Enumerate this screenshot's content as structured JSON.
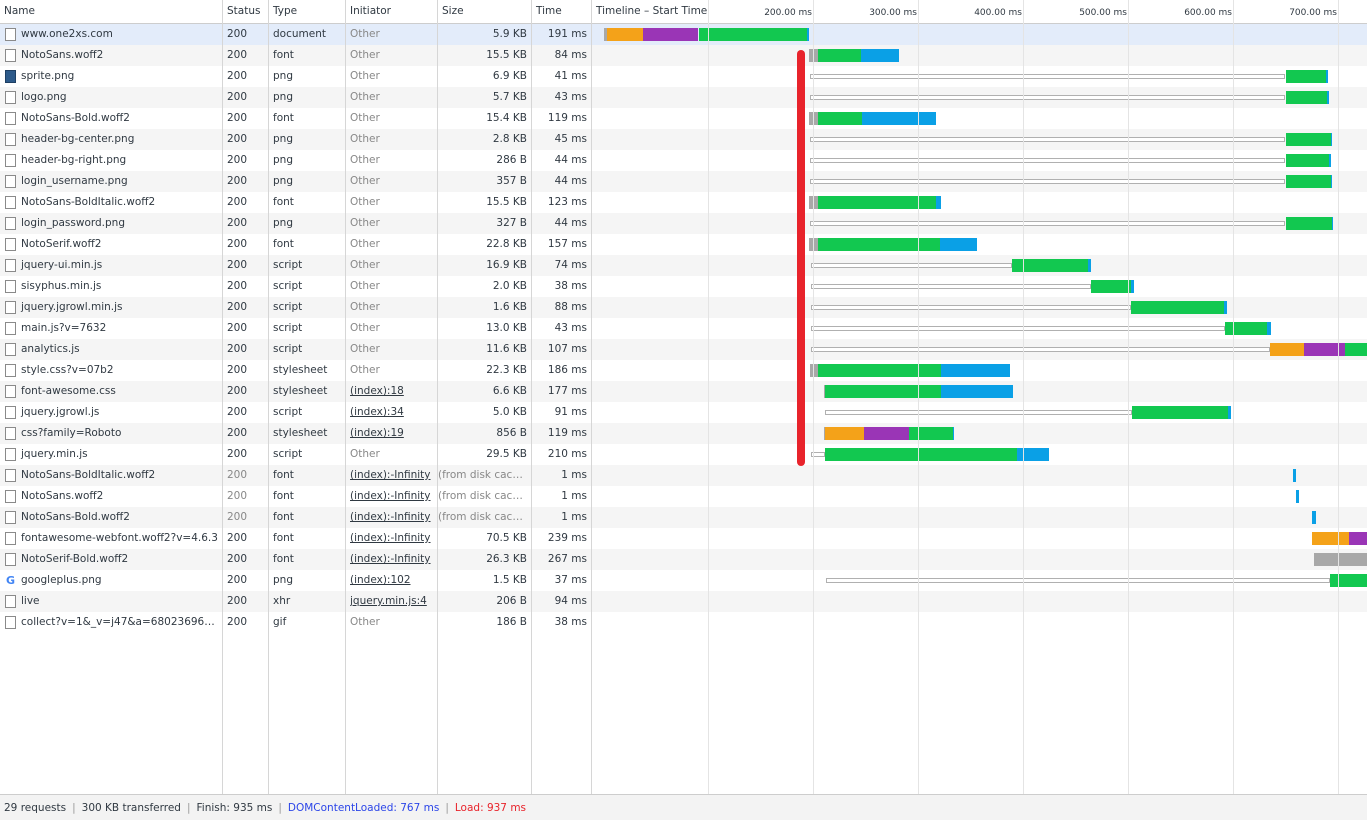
{
  "columns": {
    "name": "Name",
    "status": "Status",
    "type": "Type",
    "initiator": "Initiator",
    "size": "Size",
    "time": "Time",
    "timeline": "Timeline – Start Time"
  },
  "timeline_ticks": [
    "200.00 ms",
    "300.00 ms",
    "400.00 ms",
    "500.00 ms",
    "600.00 ms",
    "700.00 ms"
  ],
  "colors": {
    "stalled": "#a8a8a8",
    "dns": "#f4a219",
    "ssl": "#9a35b6",
    "ttfb": "#12c850",
    "download": "#0aa0e6",
    "dom_content_loaded": "#2b45e8",
    "load": "#e8232b",
    "annotation_highlight": "#e8232b"
  },
  "requests": [
    {
      "name": "www.one2xs.com",
      "status": "200",
      "type": "document",
      "initiator": "Other",
      "size": "5.9 KB",
      "time": "191 ms",
      "icon": "document-icon"
    },
    {
      "name": "NotoSans.woff2",
      "status": "200",
      "type": "font",
      "initiator": "Other",
      "size": "15.5 KB",
      "time": "84 ms",
      "icon": "file-icon"
    },
    {
      "name": "sprite.png",
      "status": "200",
      "type": "png",
      "initiator": "Other",
      "size": "6.9 KB",
      "time": "41 ms",
      "icon": "image-icon"
    },
    {
      "name": "logo.png",
      "status": "200",
      "type": "png",
      "initiator": "Other",
      "size": "5.7 KB",
      "time": "43 ms",
      "icon": "file-icon"
    },
    {
      "name": "NotoSans-Bold.woff2",
      "status": "200",
      "type": "font",
      "initiator": "Other",
      "size": "15.4 KB",
      "time": "119 ms",
      "icon": "file-icon"
    },
    {
      "name": "header-bg-center.png",
      "status": "200",
      "type": "png",
      "initiator": "Other",
      "size": "2.8 KB",
      "time": "45 ms",
      "icon": "file-icon"
    },
    {
      "name": "header-bg-right.png",
      "status": "200",
      "type": "png",
      "initiator": "Other",
      "size": "286 B",
      "time": "44 ms",
      "icon": "file-icon"
    },
    {
      "name": "login_username.png",
      "status": "200",
      "type": "png",
      "initiator": "Other",
      "size": "357 B",
      "time": "44 ms",
      "icon": "user-icon"
    },
    {
      "name": "NotoSans-BoldItalic.woff2",
      "status": "200",
      "type": "font",
      "initiator": "Other",
      "size": "15.5 KB",
      "time": "123 ms",
      "icon": "file-icon"
    },
    {
      "name": "login_password.png",
      "status": "200",
      "type": "png",
      "initiator": "Other",
      "size": "327 B",
      "time": "44 ms",
      "icon": "key-icon"
    },
    {
      "name": "NotoSerif.woff2",
      "status": "200",
      "type": "font",
      "initiator": "Other",
      "size": "22.8 KB",
      "time": "157 ms",
      "icon": "file-icon"
    },
    {
      "name": "jquery-ui.min.js",
      "status": "200",
      "type": "script",
      "initiator": "Other",
      "size": "16.9 KB",
      "time": "74 ms",
      "icon": "file-icon"
    },
    {
      "name": "sisyphus.min.js",
      "status": "200",
      "type": "script",
      "initiator": "Other",
      "size": "2.0 KB",
      "time": "38 ms",
      "icon": "file-icon"
    },
    {
      "name": "jquery.jgrowl.min.js",
      "status": "200",
      "type": "script",
      "initiator": "Other",
      "size": "1.6 KB",
      "time": "88 ms",
      "icon": "file-icon"
    },
    {
      "name": "main.js?v=7632",
      "status": "200",
      "type": "script",
      "initiator": "Other",
      "size": "13.0 KB",
      "time": "43 ms",
      "icon": "file-icon"
    },
    {
      "name": "analytics.js",
      "status": "200",
      "type": "script",
      "initiator": "Other",
      "size": "11.6 KB",
      "time": "107 ms",
      "icon": "file-icon"
    },
    {
      "name": "style.css?v=07b2",
      "status": "200",
      "type": "stylesheet",
      "initiator": "Other",
      "size": "22.3 KB",
      "time": "186 ms",
      "icon": "file-icon"
    },
    {
      "name": "font-awesome.css",
      "status": "200",
      "type": "stylesheet",
      "initiator": "(index):18",
      "size": "6.6 KB",
      "time": "177 ms",
      "icon": "file-icon"
    },
    {
      "name": "jquery.jgrowl.js",
      "status": "200",
      "type": "script",
      "initiator": "(index):34",
      "size": "5.0 KB",
      "time": "91 ms",
      "icon": "file-icon"
    },
    {
      "name": "css?family=Roboto",
      "status": "200",
      "type": "stylesheet",
      "initiator": "(index):19",
      "size": "856 B",
      "time": "119 ms",
      "icon": "file-icon"
    },
    {
      "name": "jquery.min.js",
      "status": "200",
      "type": "script",
      "initiator": "Other",
      "size": "29.5 KB",
      "time": "210 ms",
      "icon": "file-icon"
    },
    {
      "name": "NotoSans-BoldItalic.woff2",
      "status": "200",
      "type": "font",
      "initiator": "(index):-Infinity",
      "size": "(from disk cache)",
      "time": "1 ms",
      "icon": "file-icon"
    },
    {
      "name": "NotoSans.woff2",
      "status": "200",
      "type": "font",
      "initiator": "(index):-Infinity",
      "size": "(from disk cache)",
      "time": "1 ms",
      "icon": "file-icon"
    },
    {
      "name": "NotoSans-Bold.woff2",
      "status": "200",
      "type": "font",
      "initiator": "(index):-Infinity",
      "size": "(from disk cache)",
      "time": "1 ms",
      "icon": "file-icon"
    },
    {
      "name": "fontawesome-webfont.woff2?v=4.6.3",
      "status": "200",
      "type": "font",
      "initiator": "(index):-Infinity",
      "size": "70.5 KB",
      "time": "239 ms",
      "icon": "file-icon"
    },
    {
      "name": "NotoSerif-Bold.woff2",
      "status": "200",
      "type": "font",
      "initiator": "(index):-Infinity",
      "size": "26.3 KB",
      "time": "267 ms",
      "icon": "file-icon"
    },
    {
      "name": "googleplus.png",
      "status": "200",
      "type": "png",
      "initiator": "(index):102",
      "size": "1.5 KB",
      "time": "37 ms",
      "icon": "google-icon"
    },
    {
      "name": "live",
      "status": "200",
      "type": "xhr",
      "initiator": "jquery.min.js:4",
      "size": "206 B",
      "time": "94 ms",
      "icon": "file-icon"
    },
    {
      "name": "collect?v=1&_v=j47&a=680236966&t...",
      "status": "200",
      "type": "gif",
      "initiator": "Other",
      "size": "186 B",
      "time": "38 ms",
      "icon": "file-icon"
    }
  ],
  "summary": {
    "requests": "29 requests",
    "transferred": "300 KB transferred",
    "finish": "Finish: 935 ms",
    "dom_content_loaded": "DOMContentLoaded: 767 ms",
    "load": "Load: 937 ms"
  }
}
